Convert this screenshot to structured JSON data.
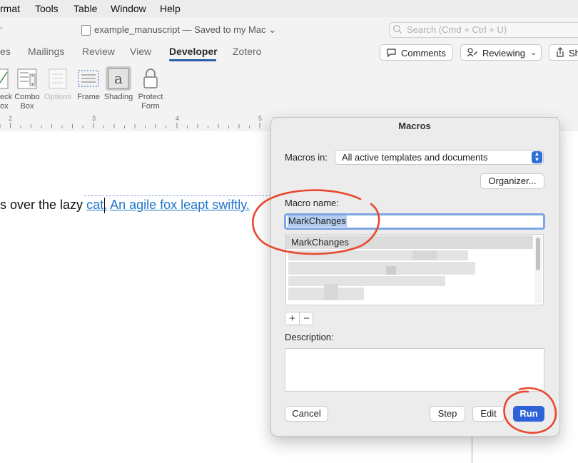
{
  "menubar": {
    "items": [
      "rmat",
      "Tools",
      "Table",
      "Window",
      "Help"
    ]
  },
  "titlebar": {
    "document_name": "example_manuscript — Saved to my Mac",
    "chevron": "⌄",
    "search_placeholder": "Search (Cmd + Ctrl + U)"
  },
  "ribbon_tabs": {
    "items": [
      "es",
      "Mailings",
      "Review",
      "View",
      "Developer",
      "Zotero"
    ],
    "active": "Developer"
  },
  "ribbon_buttons": {
    "comments": "Comments",
    "reviewing": "Reviewing",
    "share": "Sh"
  },
  "ribbon_tools": {
    "check_box": [
      "eck",
      "ox"
    ],
    "combo_box": [
      "Combo",
      "Box"
    ],
    "options": "Options",
    "frame": "Frame",
    "shading": "Shading",
    "protect_form": [
      "Protect",
      "Form"
    ]
  },
  "ruler": {
    "numbers": [
      "2",
      "3",
      "4",
      "5"
    ]
  },
  "document": {
    "plain_text": "s over the lazy ",
    "link_word": "cat",
    "link_sentence": "An agile fox leapt swiftly."
  },
  "dialog": {
    "title": "Macros",
    "macros_in_label": "Macros in:",
    "macros_in_value": "All active templates and documents",
    "organizer_button": "Organizer...",
    "macro_name_label": "Macro name:",
    "macro_name_value": "MarkChanges",
    "macro_list": [
      "MarkChanges"
    ],
    "add_symbol": "+",
    "remove_symbol": "−",
    "description_label": "Description:",
    "description_value": "",
    "cancel_button": "Cancel",
    "step_button": "Step",
    "edit_button": "Edit",
    "run_button": "Run"
  },
  "colors": {
    "accent": "#2f62d8",
    "annotation": "#e8482e",
    "link": "#1f74c8",
    "tab_underline": "#2a5ea8"
  },
  "icons": {
    "menu_left_chevron": "chevron-left-icon",
    "comments": "speech-bubble-icon",
    "reviewing": "track-changes-icon",
    "share": "share-icon",
    "search": "search-icon"
  }
}
